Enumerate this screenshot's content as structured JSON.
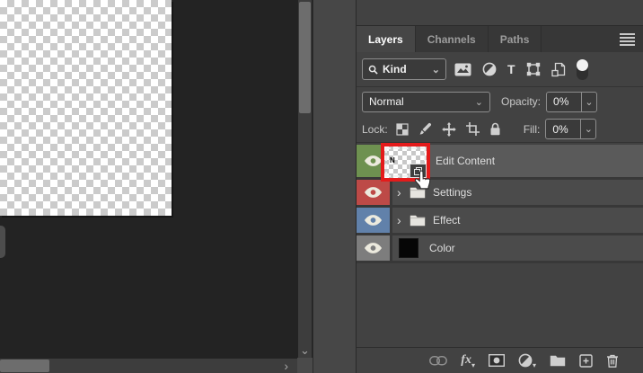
{
  "ui": {
    "chevron_down": "⌄",
    "expand_chevron": "›",
    "scroll_right_glyph": "›",
    "scroll_down_glyph": "⌄",
    "caret_glyph": "▾"
  },
  "panel": {
    "tabs": [
      {
        "label": "Layers",
        "active": true
      },
      {
        "label": "Channels",
        "active": false
      },
      {
        "label": "Paths",
        "active": false
      }
    ],
    "filter": {
      "kind_label": "Kind",
      "type_glyph": "T",
      "icons": [
        "pixel-layers-filter",
        "adjustment-layers-filter",
        "type-layers-filter",
        "shape-layers-filter",
        "smart-objects-filter",
        "layer-filtering-toggle"
      ]
    },
    "blend": {
      "mode": "Normal",
      "opacity_label": "Opacity:",
      "opacity_value": "0%"
    },
    "lock": {
      "label": "Lock:",
      "icons": [
        "lock-transparent-pixels",
        "lock-image-pixels",
        "lock-position",
        "lock-artboard",
        "lock-all"
      ],
      "fill_label": "Fill:",
      "fill_value": "0%"
    },
    "layers": [
      {
        "name": "Edit Content",
        "eye_color": "#6e9150",
        "kind": "smart-object",
        "selected": true,
        "highlight_color": "#e41b1b",
        "thumb_marks": "N"
      },
      {
        "name": "Settings",
        "eye_color": "#bd4a47",
        "kind": "group",
        "selected": false
      },
      {
        "name": "Effect",
        "eye_color": "#6181aa",
        "kind": "group",
        "selected": false
      },
      {
        "name": "Color",
        "eye_color": "#7d7d7d",
        "kind": "fill",
        "swatch_color": "#060606",
        "selected": false
      }
    ],
    "toolbar": {
      "fx_label": "fx",
      "icons": [
        "link-layers",
        "layer-style",
        "add-layer-mask",
        "new-adjustment-layer",
        "new-group",
        "new-layer",
        "delete-layer"
      ]
    }
  }
}
